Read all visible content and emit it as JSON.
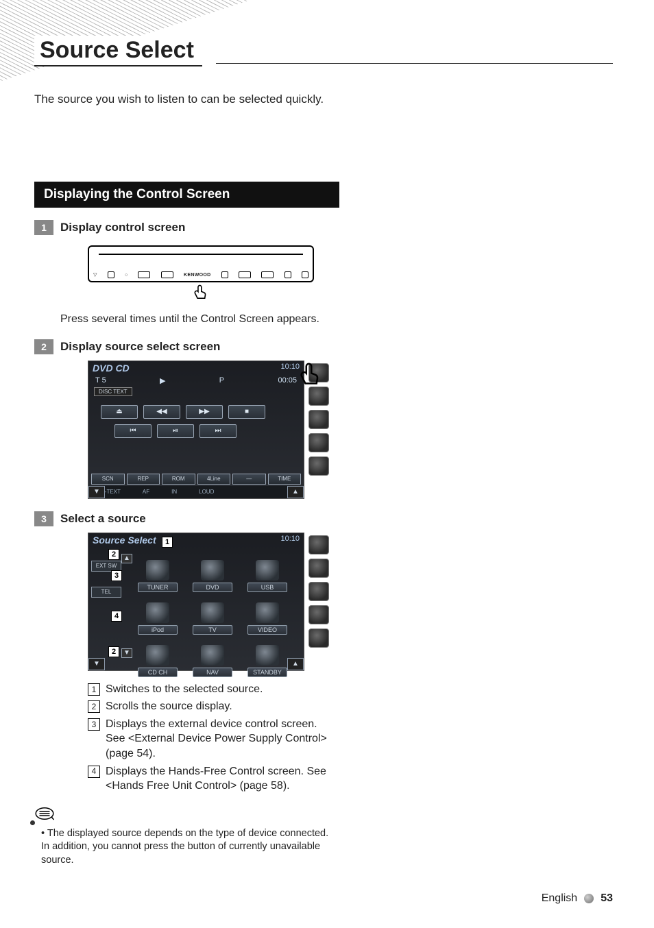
{
  "title": "Source Select",
  "intro": "The source you wish to listen to can be selected quickly.",
  "section_bar": "Displaying the Control Screen",
  "steps": {
    "1": {
      "title": "Display control screen",
      "faceplate_brand": "KENWOOD",
      "text": "Press several times until the Control Screen appears."
    },
    "2": {
      "title": "Display source select screen",
      "screen": {
        "title": "DVD CD",
        "clock": "10:10",
        "track_label": "T  5",
        "play_state": "P",
        "time": "00:05",
        "tape_btn": "DISC TEXT",
        "transport": {
          "eject": "⏏",
          "rew": "◀◀",
          "ffwd": "▶▶",
          "stop": "■",
          "prev": "⏮",
          "playpause": "⏯",
          "next": "⏭"
        },
        "footbuttons": [
          "SCN",
          "REP",
          "ROM",
          "4Line",
          "—",
          "TIME"
        ],
        "subbar": [
          "D-TEXT",
          "AF",
          "IN",
          "LOUD"
        ],
        "dnav": {
          "left": "▼",
          "right": "▲"
        }
      }
    },
    "3": {
      "title": "Select a source",
      "screen": {
        "title": "Source Select",
        "clock": "10:10",
        "leftpane": [
          "EXT SW",
          "TEL"
        ],
        "scroll_up": "▲",
        "scroll_dn": "▼",
        "sources": [
          "TUNER",
          "DVD",
          "USB",
          "iPod",
          "TV",
          "VIDEO",
          "CD CH",
          "NAV",
          "STANDBY"
        ],
        "dnav": {
          "left": "▼",
          "right": "▲"
        }
      },
      "callouts": {
        "1": "1",
        "2": "2",
        "3": "3",
        "4": "4"
      },
      "legend": {
        "1": "Switches to the selected source.",
        "2": "Scrolls the source display.",
        "3": "Displays the external device control screen. See <External Device Power Supply Control> (page 54).",
        "4": "Displays the Hands-Free Control screen. See <Hands Free Unit Control> (page 58)."
      }
    }
  },
  "note": "The displayed source depends on the type of device connected. In addition, you cannot press the button of currently unavailable source.",
  "footer": {
    "lang": "English",
    "page": "53"
  }
}
